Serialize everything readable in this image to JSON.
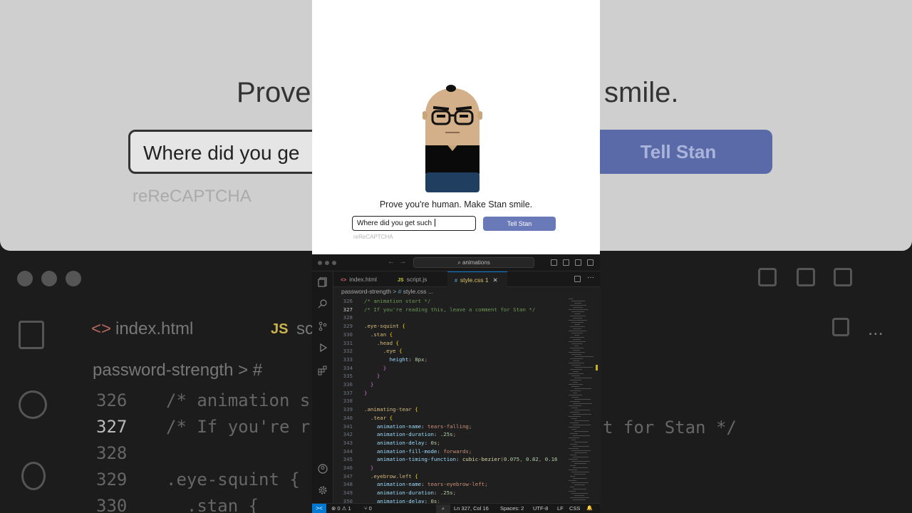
{
  "background_zoom": {
    "heading_left": "Prove y",
    "heading_right": "smile.",
    "input_text": "Where did you ge",
    "button_label": "Tell Stan",
    "captcha": "reReCAPTCHA",
    "tab_html": "index.html",
    "tab_js_icon": "JS",
    "tab_js": "sc",
    "crumb": "password-strength",
    "crumb_sep": ">",
    "crumb_hash": "#",
    "lines": [
      {
        "num": "326",
        "text": "/* animation s"
      },
      {
        "num": "327",
        "text": "/* If you're r"
      },
      {
        "num": "328",
        "text": ""
      },
      {
        "num": "329",
        "text": ".eye-squint {"
      },
      {
        "num": "330",
        "text": "  .stan {"
      }
    ],
    "right_fragment": "t for Stan */",
    "dots": "..."
  },
  "webpage": {
    "prompt": "Prove you're human. Make Stan smile.",
    "input_value": "Where did you get such ",
    "button_label": "Tell Stan",
    "captcha_label": "reReCAPTCHA"
  },
  "vscode": {
    "search": "animations",
    "tabs": [
      {
        "icon": "<>",
        "label": "index.html",
        "active": false
      },
      {
        "icon": "JS",
        "label": "script.js",
        "active": false
      },
      {
        "icon": "#",
        "label": "style.css 1",
        "active": true
      }
    ],
    "breadcrumb": {
      "folder": "password-strength",
      "sep": ">",
      "hash": "#",
      "file": "style.css",
      "more": "..."
    },
    "code": [
      {
        "num": "326",
        "text": "/* animation start */"
      },
      {
        "num": "327",
        "text": "/* If you're reading this, leave a comment for Stan */"
      },
      {
        "num": "328",
        "text": ""
      },
      {
        "num": "329",
        "text": ".eye-squint {"
      },
      {
        "num": "330",
        "text": "  .stan {"
      },
      {
        "num": "331",
        "text": "    .head {"
      },
      {
        "num": "332",
        "text": "      .eye {"
      },
      {
        "num": "333",
        "text": "        height: 8px;"
      },
      {
        "num": "334",
        "text": "      }"
      },
      {
        "num": "335",
        "text": "    }"
      },
      {
        "num": "336",
        "text": "  }"
      },
      {
        "num": "337",
        "text": "}"
      },
      {
        "num": "338",
        "text": ""
      },
      {
        "num": "339",
        "text": ".animating-tear {"
      },
      {
        "num": "340",
        "text": "  .tear {"
      },
      {
        "num": "341",
        "text": "    animation-name: tears-falling;"
      },
      {
        "num": "342",
        "text": "    animation-duration: .25s;"
      },
      {
        "num": "343",
        "text": "    animation-delay: 0s;"
      },
      {
        "num": "344",
        "text": "    animation-fill-mode: forwards;"
      },
      {
        "num": "345",
        "text": "    animation-timing-function: cubic-bezier(0.075, 0.82, 0.16"
      },
      {
        "num": "346",
        "text": "  }"
      },
      {
        "num": "347",
        "text": "  .eyebrow.left {"
      },
      {
        "num": "348",
        "text": "    animation-name: tears-eyebrow-left;"
      },
      {
        "num": "349",
        "text": "    animation-duration: .25s;"
      },
      {
        "num": "350",
        "text": "    animation-delay: 0s;"
      }
    ],
    "current_line": "327",
    "status": {
      "remote": "><",
      "errors": "0",
      "warnings": "1",
      "ports": "0",
      "zoom": "⌕",
      "position": "Ln 327, Col 16",
      "spaces": "Spaces: 2",
      "encoding": "UTF-8",
      "eol": "LF",
      "language": "CSS",
      "bell": "🔔"
    }
  }
}
